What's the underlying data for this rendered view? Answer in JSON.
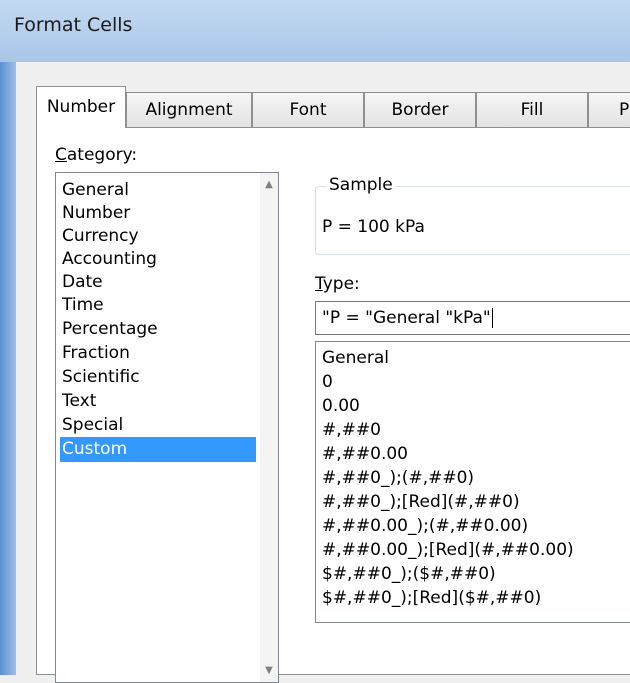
{
  "window": {
    "title": "Format Cells"
  },
  "tabs": [
    {
      "label": "Number"
    },
    {
      "label": "Alignment"
    },
    {
      "label": "Font"
    },
    {
      "label": "Border"
    },
    {
      "label": "Fill"
    },
    {
      "label": "Pr"
    }
  ],
  "category": {
    "label_underlined": "C",
    "label_rest": "ategory:",
    "items": [
      "General",
      "Number",
      "Currency",
      "Accounting",
      "Date",
      "Time",
      "Percentage",
      "Fraction",
      "Scientific",
      "Text",
      "Special",
      "Custom"
    ],
    "selected": "Custom"
  },
  "sample": {
    "legend": "Sample",
    "value": "P = 100 kPa"
  },
  "type": {
    "label_underlined": "T",
    "label_rest": "ype:",
    "value": "\"P = \"General \"kPa\""
  },
  "formats": [
    "General",
    "0",
    "0.00",
    "#,##0",
    "#,##0.00",
    "#,##0_);(#,##0)",
    "#,##0_);[Red](#,##0)",
    "#,##0.00_);(#,##0.00)",
    "#,##0.00_);[Red](#,##0.00)",
    "$#,##0_);($#,##0)",
    "$#,##0_);[Red]($#,##0)"
  ],
  "icons": {
    "scroll_up": "triangle-up",
    "scroll_down": "triangle-down"
  }
}
